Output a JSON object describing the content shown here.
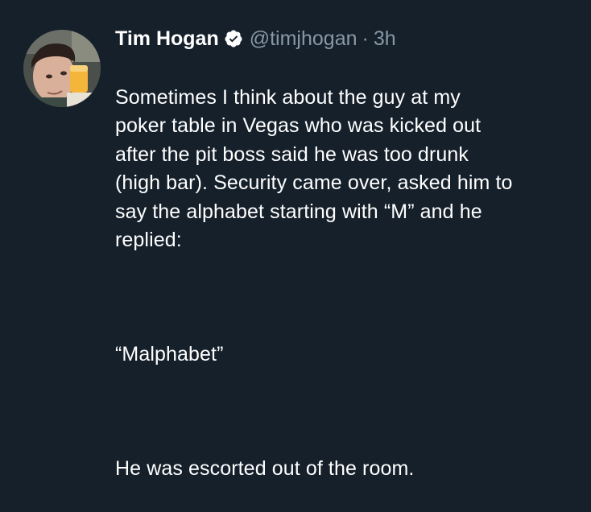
{
  "tweet": {
    "author": {
      "display_name": "Tim Hogan",
      "handle": "@timjhogan",
      "verified": true,
      "avatar_icon": "profile-photo"
    },
    "separator": "·",
    "timestamp": "3h",
    "paragraphs": [
      "Sometimes I think about the guy at my\npoker table in Vegas who was kicked out\nafter the pit boss said he was too drunk\n(high bar). Security came over, asked him to\nsay the alphabet starting with “M” and he\nreplied:",
      "“Malphabet”",
      "He was escorted out of the room."
    ]
  },
  "colors": {
    "background": "#15202b",
    "text": "#ffffff",
    "secondary_text": "#8899a6",
    "verified_badge": "#ffffff"
  }
}
